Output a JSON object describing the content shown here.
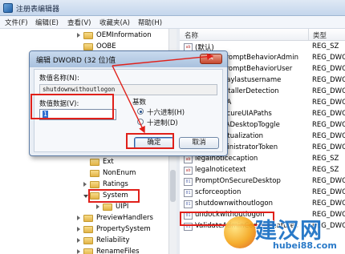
{
  "window": {
    "title": "注册表编辑器",
    "menu": [
      "文件(F)",
      "编辑(E)",
      "查看(V)",
      "收藏夹(A)",
      "帮助(H)"
    ]
  },
  "tree": {
    "items": [
      {
        "label": "OEMInformation"
      },
      {
        "label": "OOBE"
      },
      {
        "label": "Ext"
      },
      {
        "label": "NonEnum"
      },
      {
        "label": "Ratings"
      },
      {
        "label": "System"
      },
      {
        "label": "UIPI"
      },
      {
        "label": "PreviewHandlers"
      },
      {
        "label": "PropertySystem"
      },
      {
        "label": "Reliability"
      },
      {
        "label": "RenameFiles"
      }
    ]
  },
  "list": {
    "col_name": "名称",
    "col_type": "类型",
    "rows": [
      {
        "name": "(默认)",
        "type": "REG_SZ",
        "icon": "ab"
      },
      {
        "name": "consentPromptBehaviorAdmin",
        "type": "REG_DWORD",
        "icon": "01"
      },
      {
        "name": "consentPromptBehaviorUser",
        "type": "REG_DWORD",
        "icon": "01"
      },
      {
        "name": "dontdisplaylastusername",
        "type": "REG_DWORD",
        "icon": "01"
      },
      {
        "name": "EnableInstallerDetection",
        "type": "REG_DWORD",
        "icon": "01"
      },
      {
        "name": "EnableLUA",
        "type": "REG_DWORD",
        "icon": "01"
      },
      {
        "name": "EnableSecureUIAPaths",
        "type": "REG_DWORD",
        "icon": "01"
      },
      {
        "name": "EnableUIADesktopToggle",
        "type": "REG_DWORD",
        "icon": "01"
      },
      {
        "name": "EnableVirtualization",
        "type": "REG_DWORD",
        "icon": "01"
      },
      {
        "name": "FilterAdministratorToken",
        "type": "REG_DWORD",
        "icon": "01"
      },
      {
        "name": "legalnoticecaption",
        "type": "REG_SZ",
        "icon": "ab"
      },
      {
        "name": "legalnoticetext",
        "type": "REG_SZ",
        "icon": "ab"
      },
      {
        "name": "PromptOnSecureDesktop",
        "type": "REG_DWORD",
        "icon": "01"
      },
      {
        "name": "scforceoption",
        "type": "REG_DWORD",
        "icon": "01"
      },
      {
        "name": "shutdownwithoutlogon",
        "type": "REG_DWORD",
        "icon": "01"
      },
      {
        "name": "undockwithoutlogon",
        "type": "REG_DWORD",
        "icon": "01"
      },
      {
        "name": "ValidateAdminCodeSignatures",
        "type": "REG_DWORD",
        "icon": "01"
      }
    ]
  },
  "dialog": {
    "title": "编辑 DWORD (32 位)值",
    "close_label": "✕",
    "name_label": "数值名称(N):",
    "name_value": "shutdownwithoutlogon",
    "data_label": "数值数据(V):",
    "data_value": "1",
    "base_label": "基数",
    "hex_label": "十六进制(H)",
    "dec_label": "十进制(D)",
    "ok_label": "确定",
    "cancel_label": "取消"
  },
  "watermark": {
    "text": "建汉网",
    "sub": "hubei88.com"
  },
  "colors": {
    "highlight": "#e0201a",
    "watermark": "#1f73c6"
  }
}
